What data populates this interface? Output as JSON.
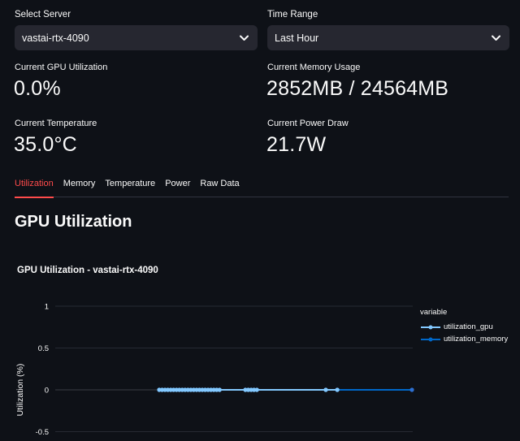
{
  "controls": {
    "server": {
      "label": "Select Server",
      "value": "vastai-rtx-4090"
    },
    "time_range": {
      "label": "Time Range",
      "value": "Last Hour"
    }
  },
  "metrics": {
    "gpu_util": {
      "label": "Current GPU Utilization",
      "value": "0.0%"
    },
    "memory": {
      "label": "Current Memory Usage",
      "value": "2852MB / 24564MB"
    },
    "temperature": {
      "label": "Current Temperature",
      "value": "35.0°C"
    },
    "power": {
      "label": "Current Power Draw",
      "value": "21.7W"
    }
  },
  "tabs": [
    "Utilization",
    "Memory",
    "Temperature",
    "Power",
    "Raw Data"
  ],
  "active_tab": 0,
  "section_title": "GPU Utilization",
  "chart_data": {
    "type": "line",
    "title": "GPU Utilization - vastai-rtx-4090",
    "ylabel": "Utilization (%)",
    "xlabel": "",
    "yticks": [
      1,
      0.5,
      0,
      -0.5
    ],
    "ylim": [
      -0.5,
      1
    ],
    "legend_title": "variable",
    "legend_position": "right",
    "grid": true,
    "series": [
      {
        "name": "utilization_gpu",
        "color": "#83c9ff",
        "x": [
          0,
          0.05,
          0.1,
          0.15,
          0.2,
          0.25,
          0.3,
          0.35,
          0.4,
          0.45,
          0.5,
          0.55,
          0.6,
          0.65,
          0.7,
          0.75,
          0.8,
          0.85,
          0.9,
          0.95,
          1.0,
          1.05,
          1.5,
          1.55,
          1.6,
          1.65,
          1.7,
          2.9,
          3.1
        ],
        "values": [
          0,
          0,
          0,
          0,
          0,
          0,
          0,
          0,
          0,
          0,
          0,
          0,
          0,
          0,
          0,
          0,
          0,
          0,
          0,
          0,
          0,
          0,
          0,
          0,
          0,
          0,
          0,
          0,
          0
        ]
      },
      {
        "name": "utilization_memory",
        "color": "#0068c9",
        "x": [
          0,
          0.05,
          0.1,
          0.15,
          0.2,
          0.25,
          0.3,
          0.35,
          0.4,
          0.45,
          0.5,
          0.55,
          0.6,
          0.65,
          0.7,
          0.75,
          0.8,
          0.85,
          0.9,
          0.95,
          1.0,
          1.05,
          1.5,
          1.55,
          1.6,
          1.65,
          1.7,
          2.9,
          3.1,
          4.4
        ],
        "values": [
          0,
          0,
          0,
          0,
          0,
          0,
          0,
          0,
          0,
          0,
          0,
          0,
          0,
          0,
          0,
          0,
          0,
          0,
          0,
          0,
          0,
          0,
          0,
          0,
          0,
          0,
          0,
          0,
          0,
          0
        ]
      }
    ]
  }
}
